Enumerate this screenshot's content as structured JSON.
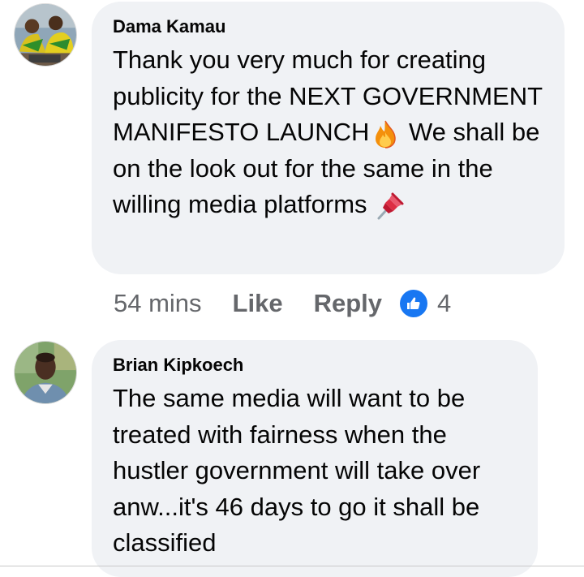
{
  "comments": [
    {
      "author": "Dama Kamau",
      "text_before_fire": "Thank you very much for  creating publicity for the NEXT GOVERNMENT MANIFESTO LAUNCH",
      "text_after_fire": " We shall be on the look out for the same in the willing media platforms ",
      "emojis": [
        "fire-icon",
        "pushpin-icon"
      ],
      "time": "54 mins",
      "like_label": "Like",
      "reply_label": "Reply",
      "reaction_count": "4"
    },
    {
      "author": "Brian Kipkoech",
      "text": "The same media will want to be treated with fairness  when the hustler government will take over anw...it's 46 days to go it shall be classified"
    }
  ],
  "colors": {
    "bubble": "#f0f2f5",
    "meta_text": "#65676b",
    "like_badge": "#1877f2"
  }
}
